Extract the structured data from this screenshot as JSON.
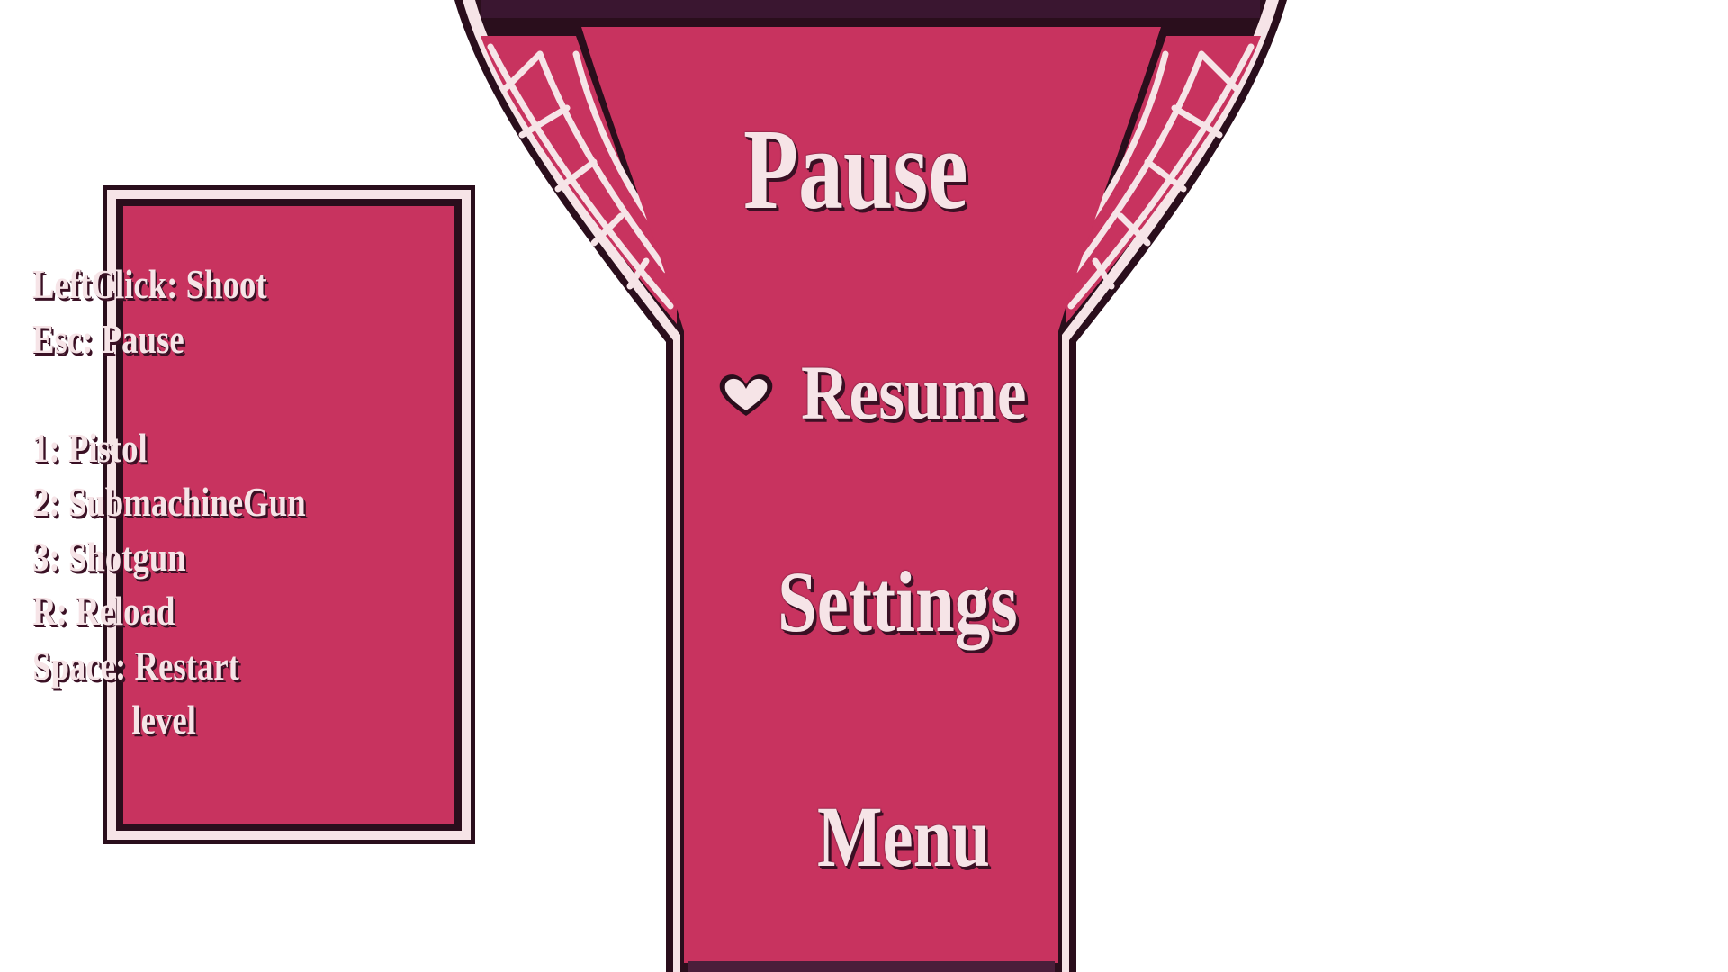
{
  "pause_menu": {
    "title": "Pause",
    "items": [
      {
        "label": "Resume",
        "selected": true
      },
      {
        "label": "Settings",
        "selected": false
      },
      {
        "label": "Menu",
        "selected": false
      }
    ],
    "selection_icon": "heart-icon"
  },
  "controls": {
    "lines": [
      "LeftClick: Shoot",
      "Esc: Pause",
      "",
      "1: Pistol",
      "2: SubmachineGun",
      "3: Shotgun",
      "R: Reload",
      "Space: Restart",
      "            level"
    ]
  },
  "colors": {
    "panel_fill": "#c8335f",
    "outline": "#2a0e1c",
    "trim": "#f6e4e7",
    "background": "#ffffff"
  }
}
